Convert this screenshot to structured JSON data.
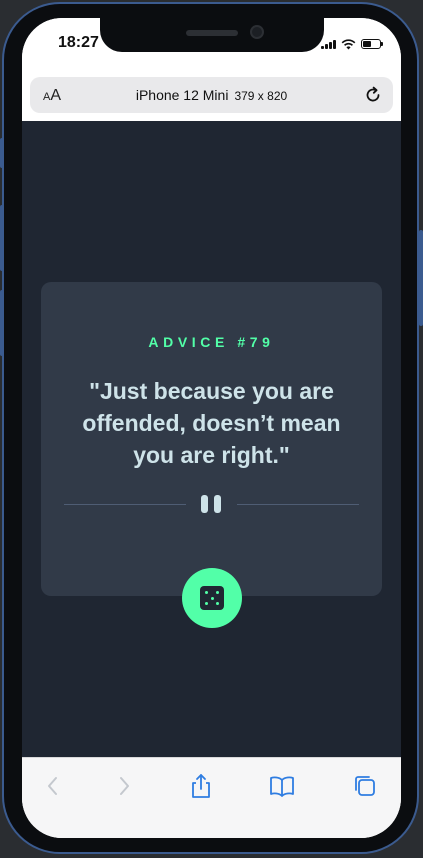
{
  "status_bar": {
    "time": "18:27"
  },
  "browser": {
    "text_size_label": "AA",
    "device_name": "iPhone 12 Mini",
    "viewport": "379 x 820"
  },
  "advice": {
    "heading": "ADVICE #79",
    "quote": "\"Just because you are offended, doesn’t mean you are right.\""
  },
  "colors": {
    "background": "#1f2632",
    "card": "#313a48",
    "accent": "#52ffa8",
    "text": "#cee3e9"
  },
  "icons": {
    "divider": "pause-icon",
    "generate": "dice-icon",
    "toolbar": [
      "back-arrow-icon",
      "forward-arrow-icon",
      "share-icon",
      "bookmarks-icon",
      "tabs-icon"
    ]
  }
}
